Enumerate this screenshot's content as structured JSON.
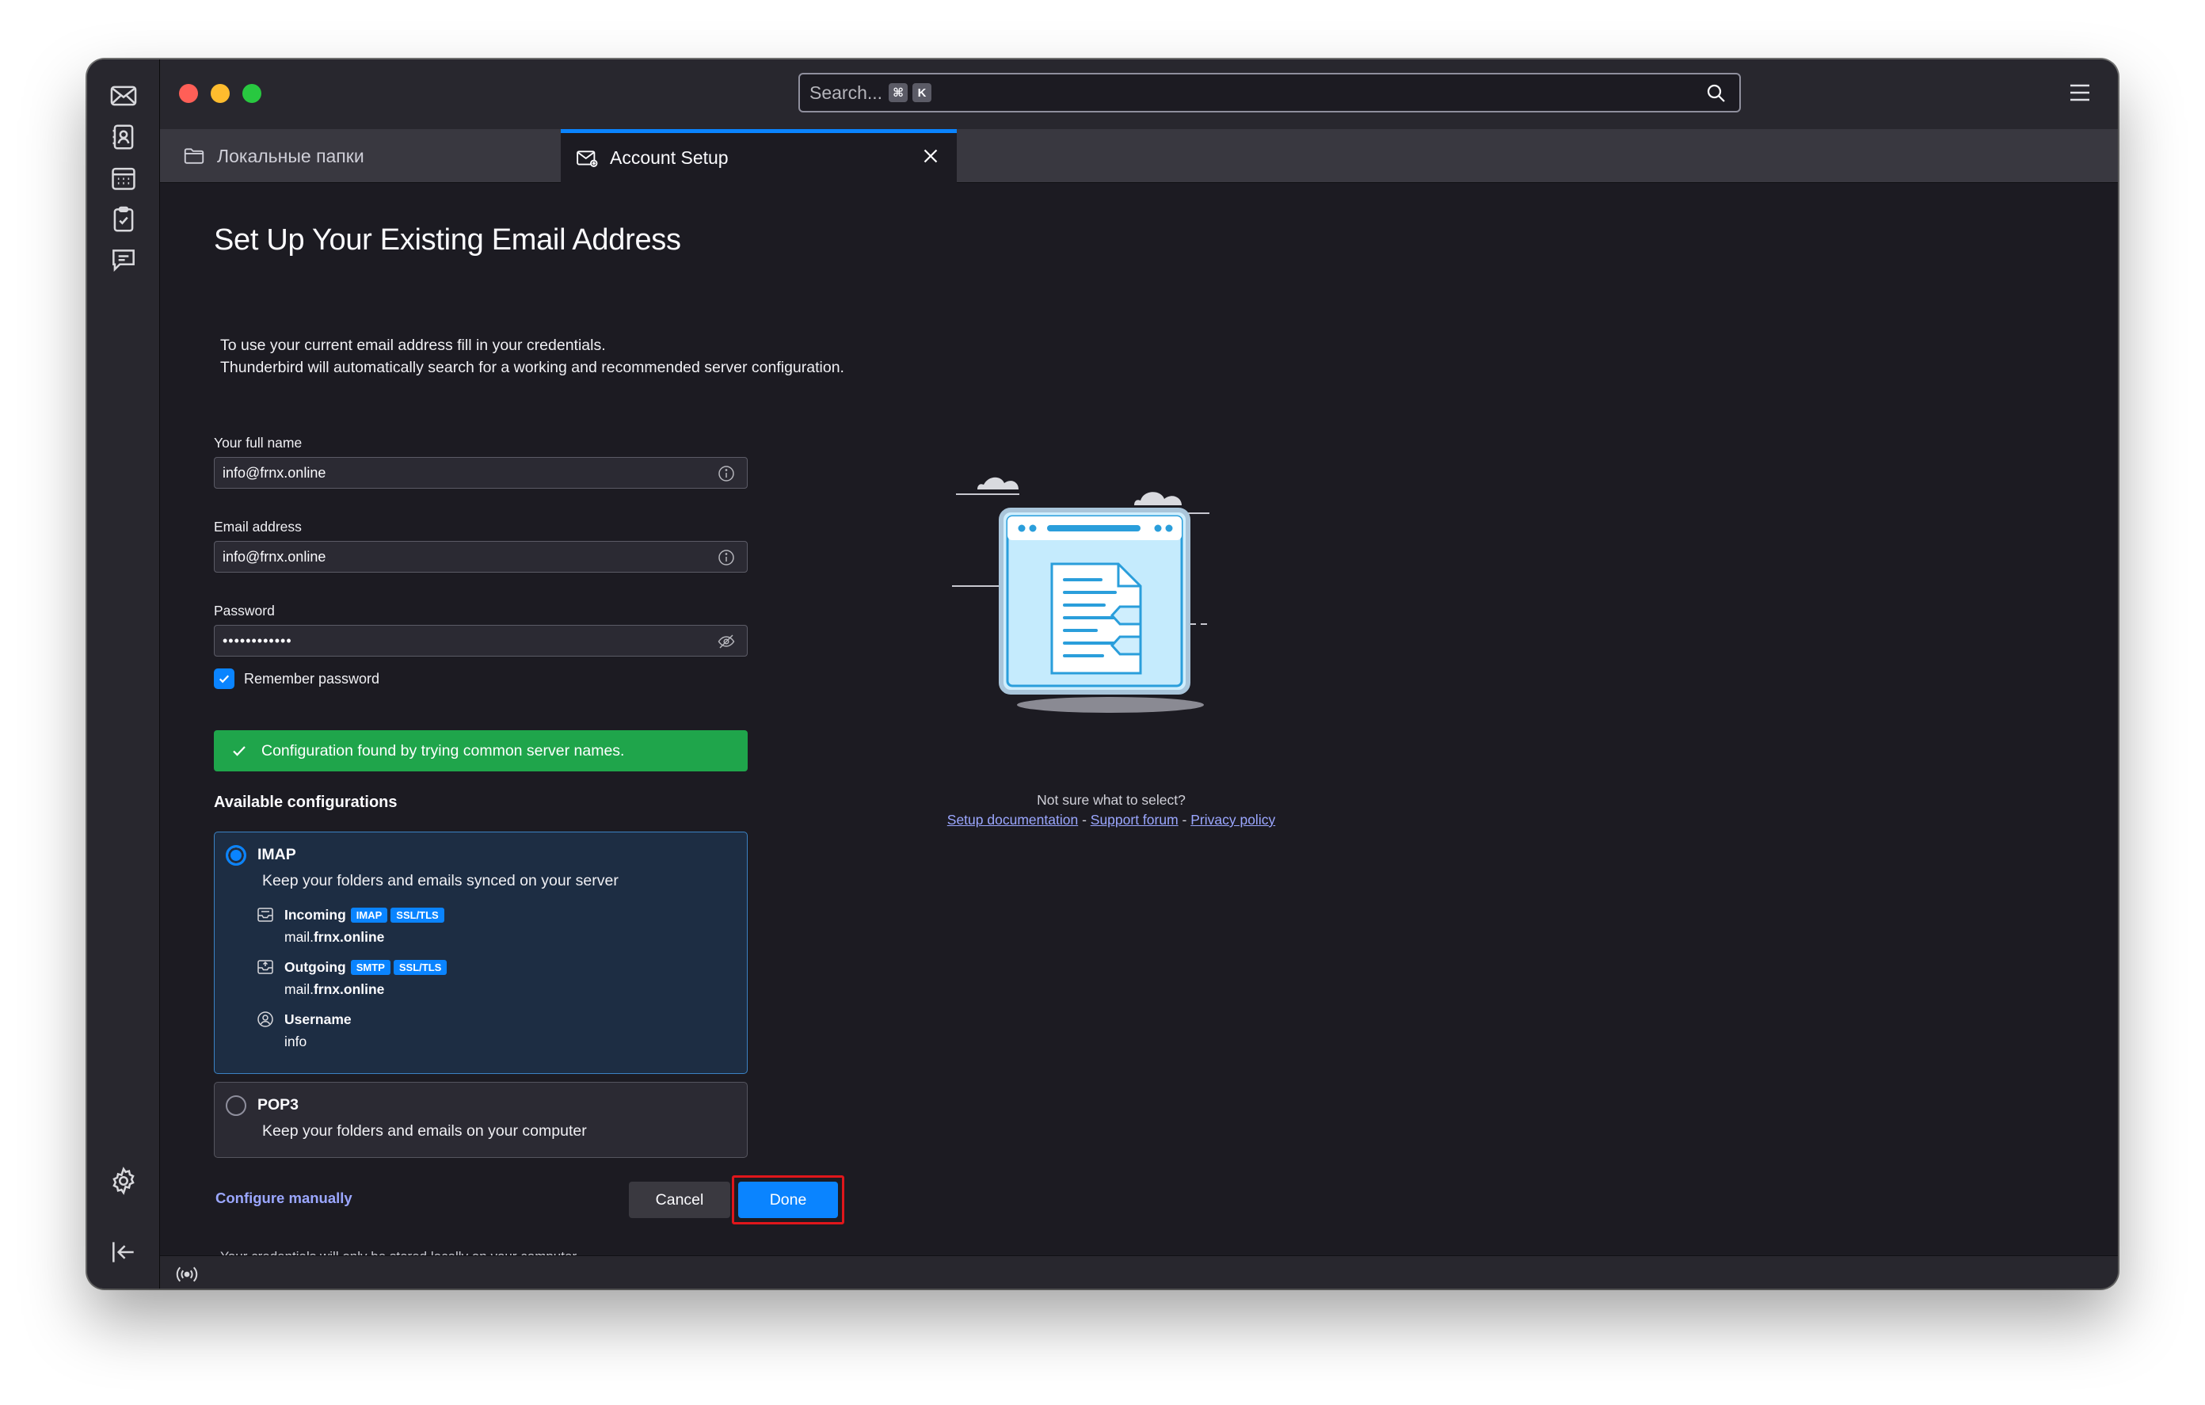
{
  "search": {
    "placeholder": "Search...",
    "kbd_cmd": "⌘",
    "kbd_key": "K"
  },
  "tabs": [
    {
      "label": "Локальные папки",
      "icon": "folder-icon"
    },
    {
      "label": "Account Setup",
      "icon": "mail-settings-icon"
    }
  ],
  "page": {
    "title": "Set Up Your Existing Email Address",
    "intro_line1": "To use your current email address fill in your credentials.",
    "intro_line2": "Thunderbird will automatically search for a working and recommended server configuration."
  },
  "form": {
    "full_name_label": "Your full name",
    "full_name_value": "info@frnx.online",
    "email_label": "Email address",
    "email_value": "info@frnx.online",
    "password_label": "Password",
    "password_value": "••••••••••••",
    "remember_label": "Remember password",
    "remember_checked": true
  },
  "notice": {
    "text": "Configuration found by trying common server names.",
    "color": "#1fa54b"
  },
  "configs": {
    "title": "Available configurations",
    "imap": {
      "name": "IMAP",
      "selected": true,
      "description": "Keep your folders and emails synced on your server",
      "incoming_label": "Incoming",
      "incoming_badges": [
        "IMAP",
        "SSL/TLS"
      ],
      "incoming_host_prefix": "mail.",
      "incoming_host_domain": "frnx.online",
      "outgoing_label": "Outgoing",
      "outgoing_badges": [
        "SMTP",
        "SSL/TLS"
      ],
      "outgoing_host_prefix": "mail.",
      "outgoing_host_domain": "frnx.online",
      "username_label": "Username",
      "username_value": "info"
    },
    "pop3": {
      "name": "POP3",
      "selected": false,
      "description": "Keep your folders and emails on your computer"
    }
  },
  "actions": {
    "configure_manually": "Configure manually",
    "cancel": "Cancel",
    "done": "Done",
    "highlight_color": "#e0161b"
  },
  "footnote": "Your credentials will only be stored locally on your computer.",
  "help": {
    "question": "Not sure what to select?",
    "links": [
      "Setup documentation",
      "Support forum",
      "Privacy policy"
    ],
    "separator": "-"
  },
  "colors": {
    "accent": "#0a84ff",
    "success": "#1fa54b",
    "background": "#1c1b22"
  }
}
